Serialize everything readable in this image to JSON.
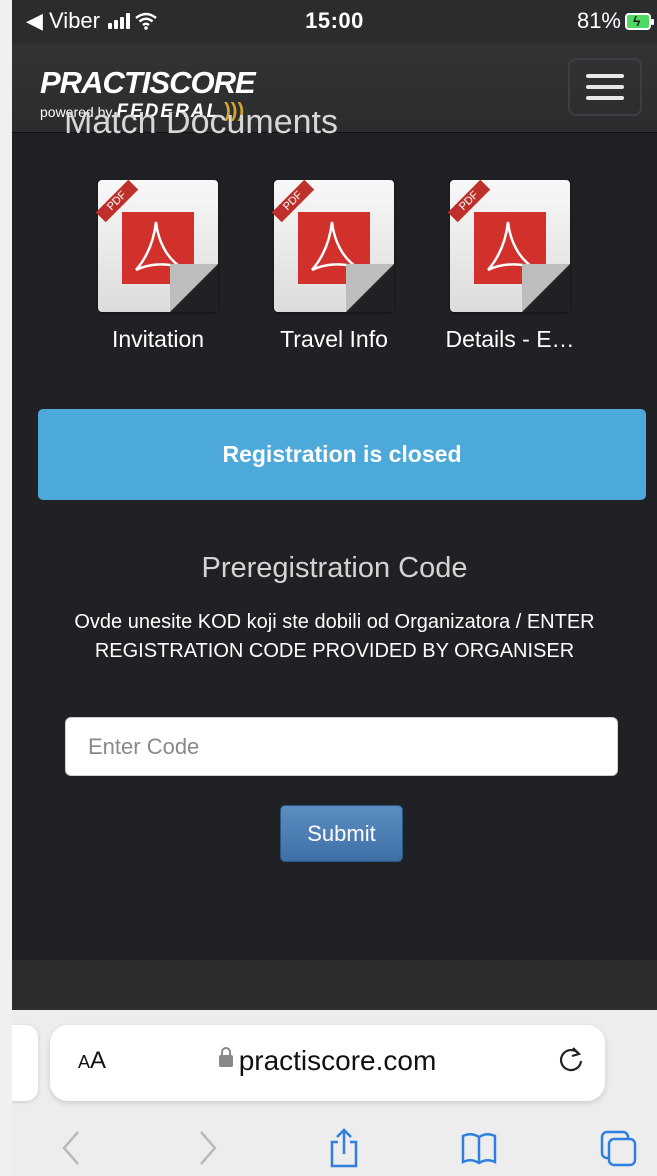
{
  "status_bar": {
    "back_app": "◀ Viber",
    "time": "15:00",
    "battery": "81%"
  },
  "header": {
    "logo_main": "PRACTISCORE",
    "logo_powered_by": "powered by",
    "logo_brand": "FEDERAL",
    "menu_icon": "hamburger-menu-icon"
  },
  "section_heading": "Match Documents",
  "documents": [
    {
      "label": "Invitation",
      "icon": "pdf-icon",
      "ribbon": "PDF"
    },
    {
      "label": "Travel Info",
      "icon": "pdf-icon",
      "ribbon": "PDF"
    },
    {
      "label": "Details - E…",
      "icon": "pdf-icon",
      "ribbon": "PDF"
    }
  ],
  "registration_banner": "Registration is closed",
  "preregistration": {
    "title": "Preregistration Code",
    "instructions": "Ovde unesite KOD koji ste dobili od Organizatora / ENTER REGISTRATION CODE PROVIDED BY ORGANISER",
    "input_placeholder": "Enter Code",
    "input_value": "",
    "submit_label": "Submit"
  },
  "browser": {
    "text_size_label_small": "A",
    "text_size_label_large": "A",
    "url": "practiscore.com"
  },
  "colors": {
    "page_bg": "#202124",
    "banner": "#4ca9d9",
    "submit": "#4a7db4",
    "pdf_red": "#d2302a"
  }
}
